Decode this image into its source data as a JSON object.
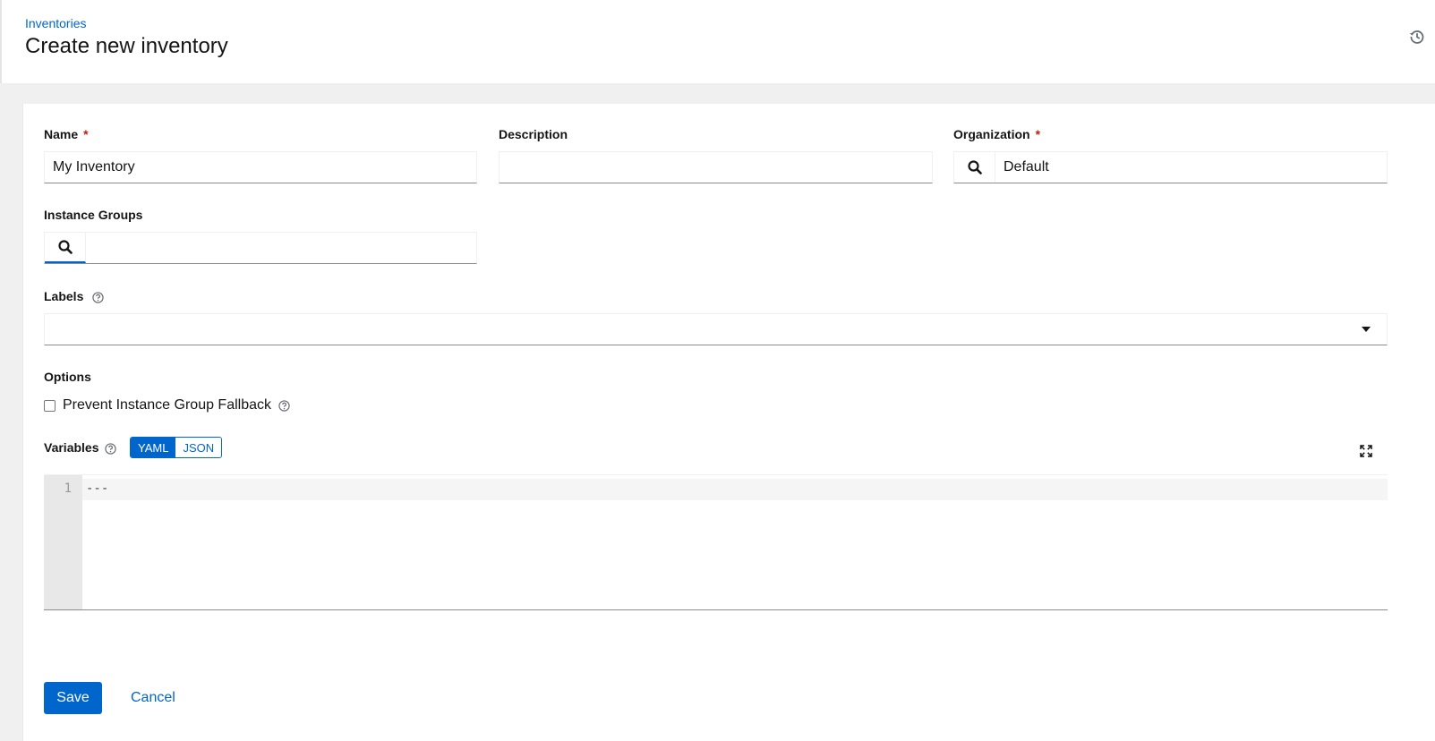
{
  "header": {
    "breadcrumb": "Inventories",
    "title": "Create new inventory",
    "history_icon": "history-icon"
  },
  "form": {
    "name": {
      "label": "Name",
      "required": "*",
      "value": "My Inventory"
    },
    "description": {
      "label": "Description",
      "value": ""
    },
    "organization": {
      "label": "Organization",
      "required": "*",
      "value": "Default",
      "icon": "search-icon"
    },
    "instance_groups": {
      "label": "Instance Groups",
      "value": "",
      "icon": "search-icon"
    },
    "labels": {
      "label": "Labels",
      "value": "",
      "icon": "help-icon"
    },
    "options": {
      "label": "Options",
      "prevent_fallback": {
        "label": "Prevent Instance Group Fallback",
        "checked": false
      }
    },
    "variables": {
      "label": "Variables",
      "modes": [
        "YAML",
        "JSON"
      ],
      "selected_mode": "YAML",
      "line_number": "1",
      "content": "---"
    }
  },
  "actions": {
    "save": "Save",
    "cancel": "Cancel"
  },
  "colors": {
    "accent": "#0066cc",
    "required": "#c9190b"
  }
}
